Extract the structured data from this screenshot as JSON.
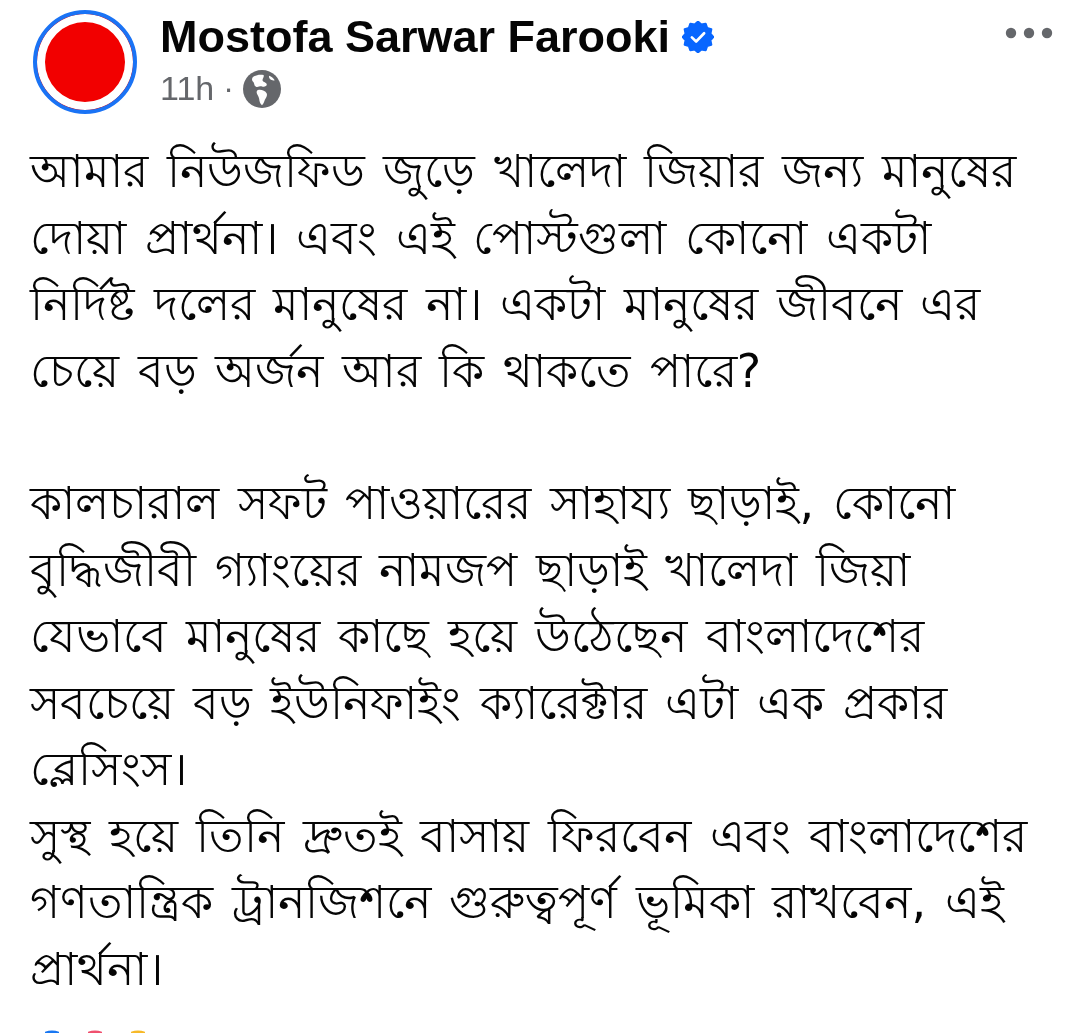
{
  "post": {
    "author": {
      "name": "Mostofa Sarwar Farooki",
      "verified": true,
      "story": true
    },
    "time": "11h",
    "separator": "·",
    "paragraphs": [
      {
        "lines": [
          "আমার নিউজফিড জুড়ে খালেদা জিয়ার জন্য মানুষের",
          "দোয়া প্রার্থনা। এবং এই পোস্টগুলা কোনো একটা",
          "নির্দিষ্ট দলের মানুষের না। একটা মানুষের জীবনে এর",
          "চেয়ে বড় অর্জন আর কি থাকতে পারে?"
        ]
      },
      {
        "lines": [
          "কালচারাল সফট পাওয়ারের সাহায্য ছাড়াই, কোনো",
          "বুদ্ধিজীবী গ্যাংয়ের নামজপ ছাড়াই খালেদা জিয়া",
          "যেভাবে মানুষের কাছে হয়ে উঠেছেন বাংলাদেশের",
          "সবচেয়ে বড় ইউনিফাইং ক্যারেক্টার এটা এক প্রকার",
          "ব্লেসিংস।",
          "সুস্থ হয়ে তিনি দ্রুতই বাসায় ফিরবেন এবং বাংলাদেশের",
          "গণতান্ত্রিক ট্রানজিশনে গুরুত্বপূর্ণ ভূমিকা রাখবেন, এই",
          "প্রার্থনা।"
        ]
      }
    ],
    "reactions": [
      {
        "color": "#1877f2"
      },
      {
        "color": "#f0506e"
      },
      {
        "color": "#f7b928"
      }
    ]
  }
}
